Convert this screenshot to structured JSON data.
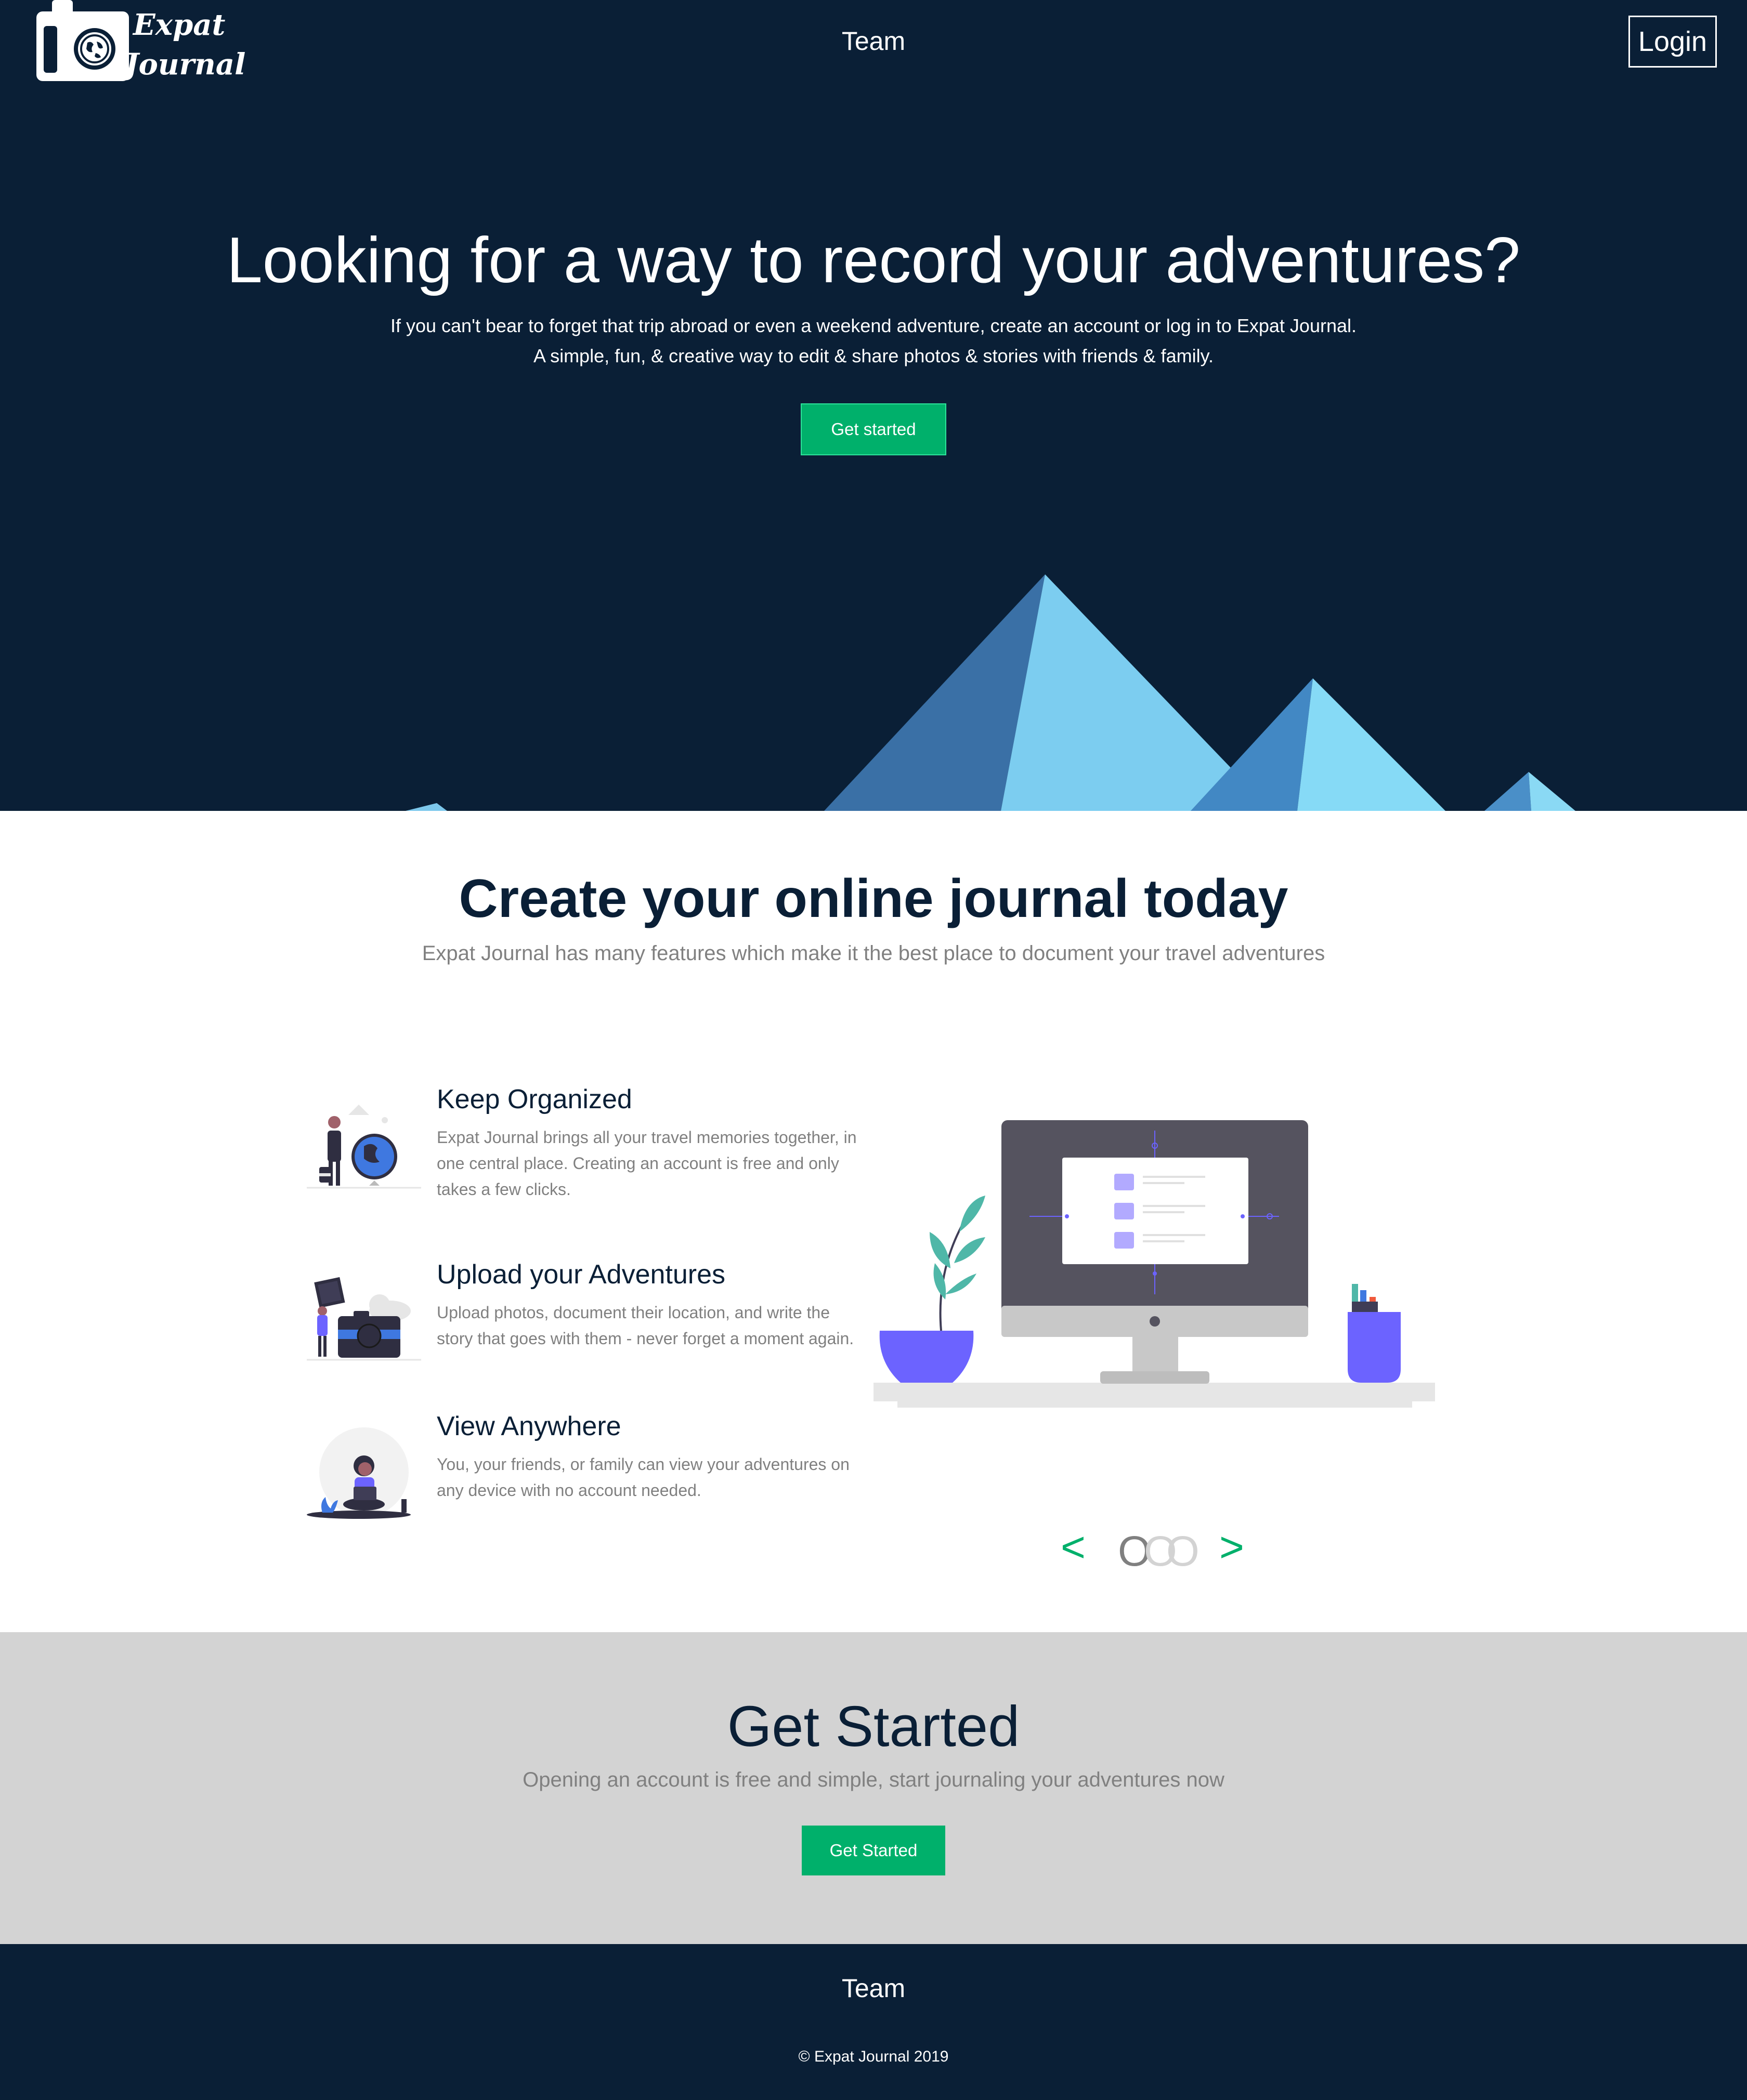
{
  "header": {
    "logo": {
      "line1": "Expat",
      "line2": "Journal"
    },
    "nav_team": "Team",
    "login": "Login"
  },
  "hero": {
    "title": "Looking for a way to record your adventures?",
    "line1": "If you can't bear to forget that trip abroad or even a weekend adventure, create an account or log in to Expat Journal.",
    "line2": "A simple, fun, & creative way to edit & share photos & stories with friends & family.",
    "button": "Get started"
  },
  "features": {
    "title": "Create your online journal today",
    "subtitle": "Expat Journal has many features which make it the best place to document your travel adventures",
    "items": [
      {
        "title": "Keep Organized",
        "text": "Expat Journal brings all your travel memories together, in one central place. Creating an account is free and only takes a few clicks.",
        "icon": "person-with-globe-illustration"
      },
      {
        "title": "Upload your Adventures",
        "text": "Upload photos, document their location, and write the story that goes with them - never forget a moment again.",
        "icon": "person-with-camera-illustration"
      },
      {
        "title": "View Anywhere",
        "text": "You, your friends, or family can view your adventures on any device with no account needed.",
        "icon": "person-with-laptop-illustration"
      }
    ],
    "carousel": {
      "prev": "<",
      "next": ">",
      "dots": [
        "O",
        "O",
        "O"
      ],
      "active_index": 0
    }
  },
  "cta": {
    "title": "Get Started",
    "subtitle": "Opening an account is free and simple, start journaling your adventures now",
    "button": "Get Started"
  },
  "footer": {
    "team": "Team",
    "copyright": "© Expat Journal 2019"
  },
  "colors": {
    "navy": "#0a1f36",
    "green": "#00b06b",
    "gray_band": "#d3d3d3",
    "muted_text": "#808080"
  }
}
